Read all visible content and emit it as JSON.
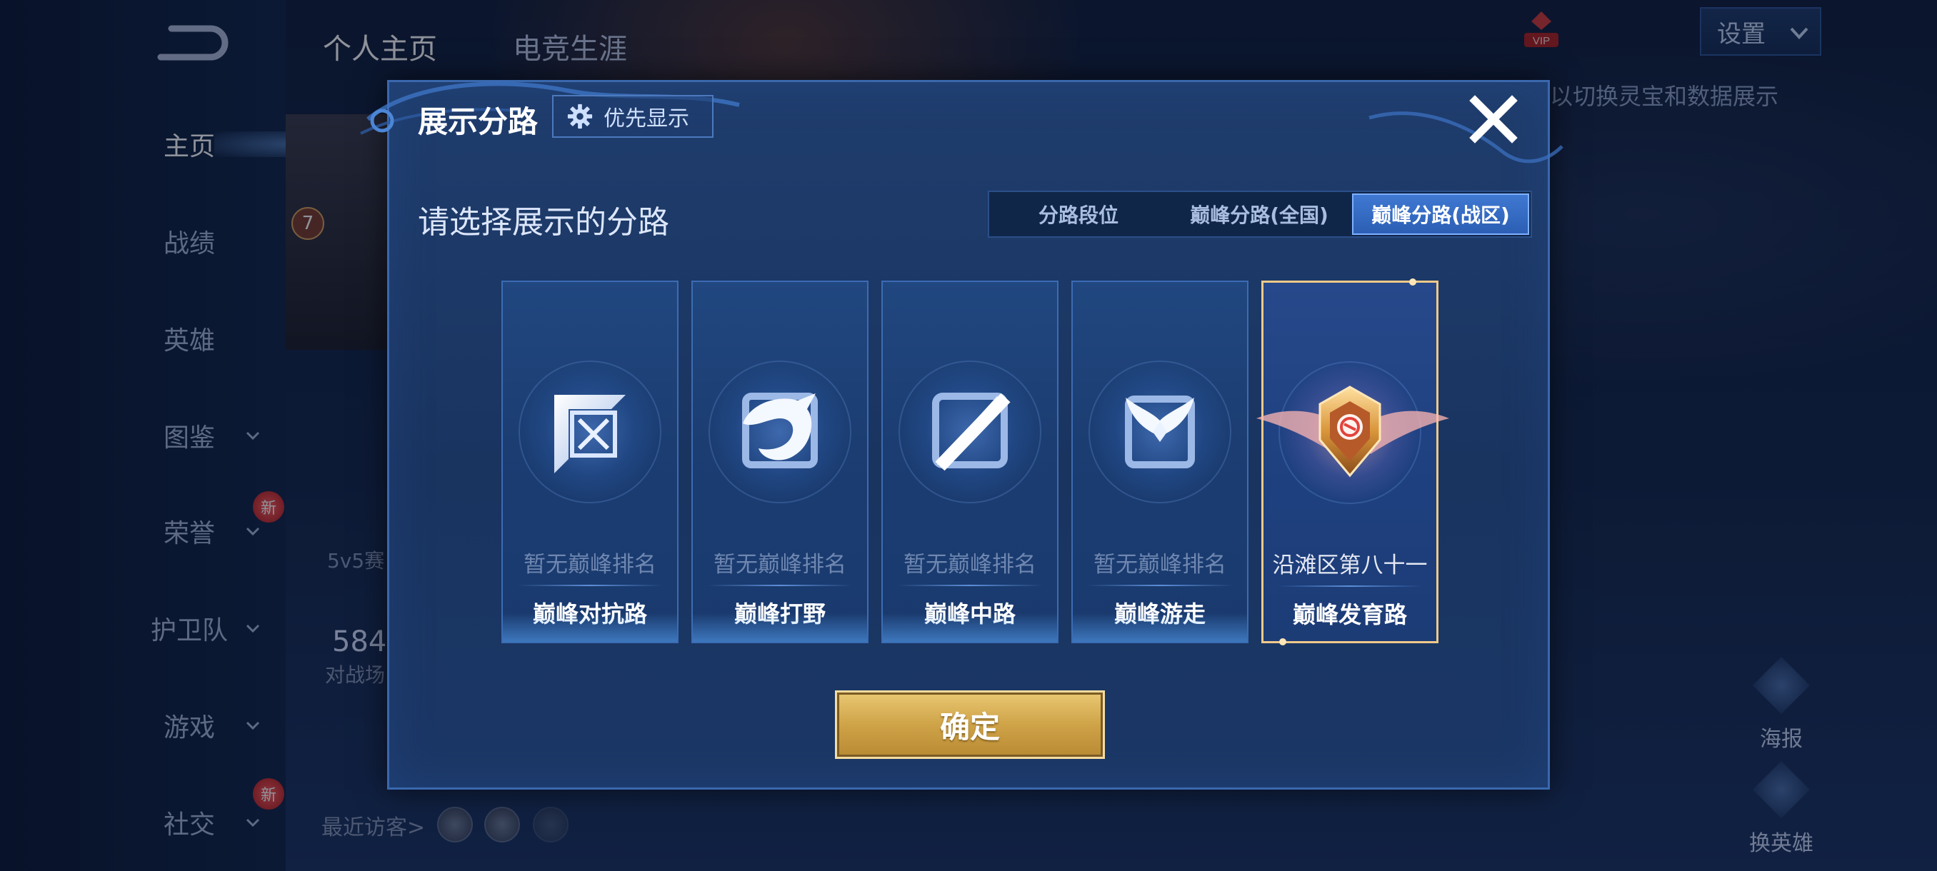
{
  "top_tabs": [
    "个人主页",
    "电竞生涯"
  ],
  "left_nav": [
    {
      "label": "主页",
      "active": true,
      "chevron": false,
      "new": false
    },
    {
      "label": "战绩",
      "active": false,
      "chevron": false,
      "new": false
    },
    {
      "label": "英雄",
      "active": false,
      "chevron": false,
      "new": false
    },
    {
      "label": "图鉴",
      "active": false,
      "chevron": true,
      "new": false
    },
    {
      "label": "荣誉",
      "active": false,
      "chevron": true,
      "new": true
    },
    {
      "label": "护卫队",
      "active": false,
      "chevron": true,
      "new": false
    },
    {
      "label": "游戏",
      "active": false,
      "chevron": true,
      "new": false
    },
    {
      "label": "社交",
      "active": false,
      "chevron": true,
      "new": true
    }
  ],
  "new_badge_text": "新",
  "profile": {
    "level_badge": "7",
    "mode_label": "5v5赛",
    "count_value": "584",
    "count_label": "对战场",
    "recent_visitors_label": "最近访客>"
  },
  "header_right": {
    "vip_label": "VIP",
    "settings_label": "设置",
    "tip_text": "以切换灵宝和数据展示"
  },
  "right_actions": [
    {
      "label": "海报",
      "icon": "poster-icon"
    },
    {
      "label": "换英雄",
      "icon": "swap-hero-icon"
    }
  ],
  "modal": {
    "title": "展示分路",
    "priority_label": "优先显示",
    "section_title": "请选择展示的分路",
    "segments": [
      {
        "label": "分路段位",
        "active": false
      },
      {
        "label": "巅峰分路(全国)",
        "active": false
      },
      {
        "label": "巅峰分路(战区)",
        "active": true
      }
    ],
    "lanes": [
      {
        "rank": "暂无巅峰排名",
        "name": "巅峰对抗路",
        "icon": "clash-lane-icon",
        "selected": false
      },
      {
        "rank": "暂无巅峰排名",
        "name": "巅峰打野",
        "icon": "jungle-dragon-icon",
        "selected": false
      },
      {
        "rank": "暂无巅峰排名",
        "name": "巅峰中路",
        "icon": "mid-lane-icon",
        "selected": false
      },
      {
        "rank": "暂无巅峰排名",
        "name": "巅峰游走",
        "icon": "roam-wings-icon",
        "selected": false
      },
      {
        "rank": "沿滩区第八十一",
        "name": "巅峰发育路",
        "icon": "farm-lane-crest-icon",
        "selected": true
      }
    ],
    "confirm_label": "确定"
  },
  "colors": {
    "modal_bg": "#1f3d6d",
    "accent_blue": "#3f78d2",
    "gold": "#cfa348",
    "selected_border": "#f0c98a"
  }
}
